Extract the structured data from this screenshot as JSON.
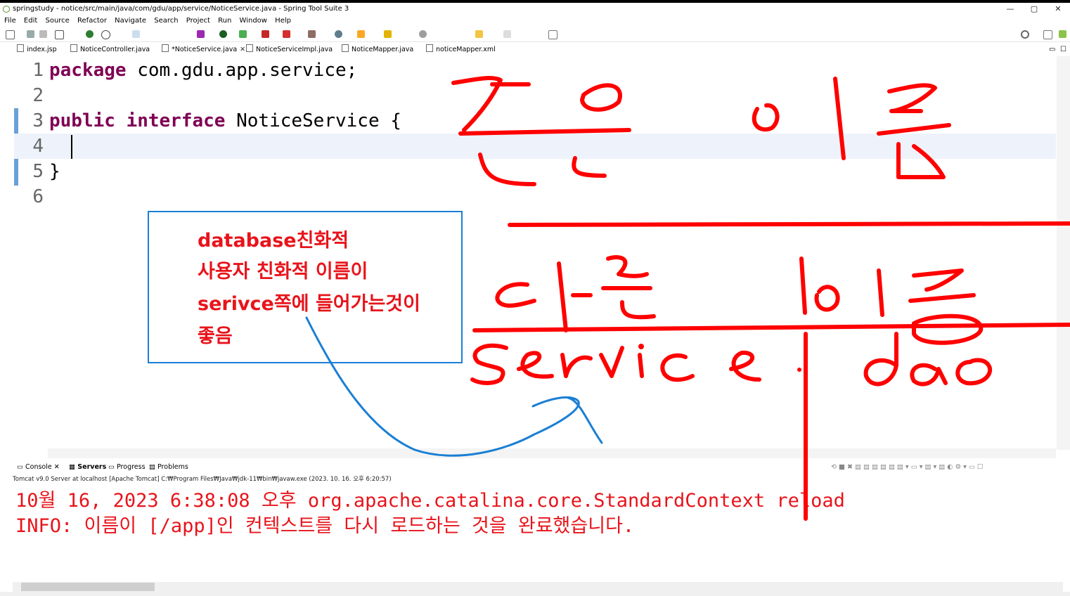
{
  "window": {
    "title": "springstudy - notice/src/main/java/com/gdu/app/service/NoticeService.java - Spring Tool Suite 3",
    "minimize": "—",
    "maximize": "▢",
    "close": "✕"
  },
  "menu": [
    "File",
    "Edit",
    "Source",
    "Refactor",
    "Navigate",
    "Search",
    "Project",
    "Run",
    "Window",
    "Help"
  ],
  "editor_tabs": [
    {
      "label": "index.jsp",
      "active": false
    },
    {
      "label": "NoticeController.java",
      "active": false
    },
    {
      "label": "*NoticeService.java",
      "active": true
    },
    {
      "label": "NoticeServiceImpl.java",
      "active": false
    },
    {
      "label": "NoticeMapper.java",
      "active": false
    },
    {
      "label": "noticeMapper.xml",
      "active": false
    }
  ],
  "code": {
    "lines": [
      {
        "num": "1",
        "kw": "package",
        "rest": " com.gdu.app.service;"
      },
      {
        "num": "2",
        "kw": "",
        "rest": ""
      },
      {
        "num": "3",
        "kw": "public interface",
        "rest": " NoticeService {"
      },
      {
        "num": "4",
        "kw": "",
        "rest": ""
      },
      {
        "num": "5",
        "kw": "",
        "rest": "}"
      },
      {
        "num": "6",
        "kw": "",
        "rest": ""
      }
    ],
    "current_line": 4
  },
  "note": {
    "lines": [
      "database친화적",
      "사용자 친화적 이름이",
      "serivce쪽에 들어가는것이",
      "좋음"
    ],
    "color": "#e8141b",
    "border_color": "#1a7fd4"
  },
  "console_tabs": [
    "Console",
    "Servers",
    "Progress",
    "Problems"
  ],
  "console": {
    "info": "Tomcat v9.0 Server at localhost [Apache Tomcat] C:₩Program Files₩Java₩jdk-11₩bin₩javaw.exe  (2023. 10. 16. 오후 6:20:57)",
    "lines": [
      "10월 16, 2023 6:38:08 오후 org.apache.catalina.core.StandardContext reload",
      "INFO: 이름이 [/app]인 컨텍스트를 다시 로드하는 것을 완료했습니다."
    ]
  },
  "handwriting": {
    "words": [
      "같은",
      "이름",
      "다른",
      "이름",
      "service",
      "dao"
    ],
    "ink_color": "#ff0000",
    "arrow_color": "#1a7fd4"
  }
}
